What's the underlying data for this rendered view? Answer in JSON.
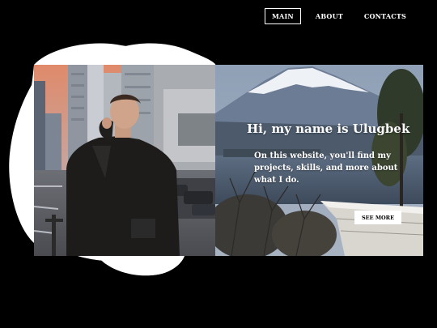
{
  "nav": {
    "items": [
      {
        "label": "MAIN",
        "active": true
      },
      {
        "label": "ABOUT",
        "active": false
      },
      {
        "label": "CONTACTS",
        "active": false
      }
    ]
  },
  "hero": {
    "title": "Hi, my name is Ulugbek",
    "description": "On this website, you'll find my projects, skills, and more about what I do.",
    "button_label": "SEE MORE"
  },
  "colors": {
    "background": "#000000",
    "blob": "#ffffff",
    "text": "#ffffff",
    "button_bg": "#ffffff",
    "button_text": "#000000"
  },
  "images": {
    "left_photo": "portrait-city-street-photo",
    "right_photo": "mount-fuji-lake-photo"
  }
}
